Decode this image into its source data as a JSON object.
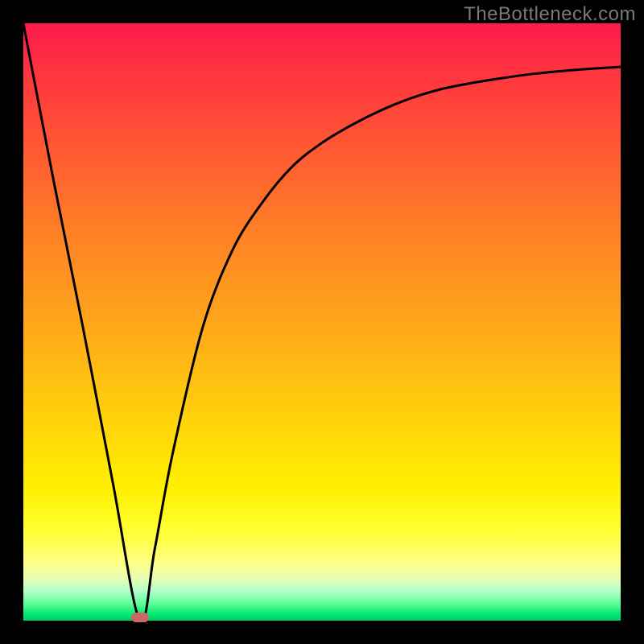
{
  "watermark": "TheBottleneck.com",
  "colors": {
    "frame": "#000000",
    "gradient_top": "#ff1a4d",
    "gradient_bottom": "#00cc66",
    "curve": "#000000",
    "marker": "#c96864"
  },
  "chart_data": {
    "type": "line",
    "title": "",
    "xlabel": "",
    "ylabel": "",
    "xlim": [
      0,
      100
    ],
    "ylim": [
      0,
      100
    ],
    "grid": false,
    "legend": false,
    "series": [
      {
        "name": "curve",
        "x": [
          0,
          5,
          10,
          15,
          19.5,
          22,
          25,
          30,
          35,
          40,
          45,
          50,
          55,
          60,
          65,
          70,
          75,
          80,
          85,
          90,
          95,
          100
        ],
        "y": [
          100,
          74,
          49,
          23,
          0,
          12,
          28,
          49,
          62,
          70,
          76,
          80,
          83,
          85.5,
          87.5,
          89,
          90,
          90.8,
          91.5,
          92,
          92.4,
          92.7
        ]
      }
    ],
    "marker": {
      "x": 19.5,
      "y": 0.5
    }
  }
}
